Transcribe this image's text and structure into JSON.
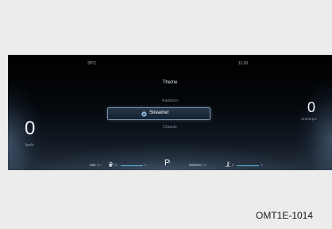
{
  "status": {
    "temperature": "39°C",
    "time": "11:30"
  },
  "menu": {
    "title": "Theme",
    "options": [
      "Fashion",
      "Streamer",
      "Classic"
    ],
    "selected": "Streamer"
  },
  "speed": {
    "value": "0",
    "unit": "km/h"
  },
  "tachometer": {
    "value": "0",
    "unit": "x1000rpm"
  },
  "bottom_bar": {
    "range_value": "666",
    "range_unit": "km",
    "fuel_empty": "E",
    "fuel_full": "F",
    "fuel_icon": "fuel-pump-icon",
    "gear": "P",
    "odometer_value": "980000",
    "odometer_unit": "km",
    "coolant_icon": "coolant-temperature-icon",
    "coolant_cold": "C",
    "coolant_hot": "H"
  },
  "colors": {
    "gauge_accent": "#5fc0e8",
    "selection_border": "#7f96ad"
  },
  "figure_code": "OMT1E-1014"
}
